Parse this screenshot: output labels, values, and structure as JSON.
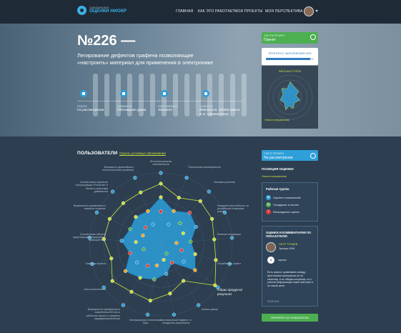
{
  "header": {
    "logo_sub": "САМОАНАЛИЗ",
    "logo_title": "ОЦЕНКИ НИОКР",
    "nav": [
      "ГЛАВНАЯ",
      "КАК ЭТО РАБОТАЕТ",
      "МОИ ПРОЕКТЫ",
      "МОЯ ПЕРСПЕКТИВА"
    ]
  },
  "hero": {
    "title": "№226 —",
    "subtitle": "Легирование дефектов графена позволяющие «настроить» материал для применения в электронике",
    "meta": [
      {
        "label": "СТАТУС",
        "value": "На рассмотрении"
      },
      {
        "label": "ДИВИЗИОН",
        "value": "Облгащение урана"
      },
      {
        "label": "НАПРАВЛЕНИЕ",
        "value": "Экология"
      },
      {
        "label": "ЗАКАЗЧИК",
        "value": "Иванов В.В. (ОКБМ имени И.И. Африкантова)"
      }
    ],
    "status_card": {
      "label": "ЭТАП ПО ПРОЕКТУ",
      "value": "Принят"
    },
    "progress": {
      "label": "ПРОГРЕСС ЗАПОЛНЕНИЯ 93%",
      "value": 0.93
    },
    "mini_radar_title": "РАБОЧАЯ ГРУППА",
    "mini_legend": "Эталон направления"
  },
  "section": {
    "title": "ПОЛЬЗОВАТЕЛИ",
    "link": "Скрыть условные обозначения",
    "highlight_label": "Образ продукта/ результат"
  },
  "radar_labels": [
    "Интеллектуальная собственность",
    "Техническая реализуемость",
    "Наличие решения",
    "Конкурентоспособность на российском и мировом рынке",
    "Наличие мотивации",
    "Потребитель клиент",
    "Образ продукта/ результат",
    "Анализ рынка",
    "Экономический эффект от внедрения результатов",
    "Материальная техническая база",
    "Возможности применения в изменённых ВН или в субъектах малого и среднего предпринимательства",
    "Опыт исполнителя",
    "Команда проекта",
    "Соответствие объекта существующей нормативно-правовой базе",
    "Возможность применения в смежных отраслях",
    "Соответствие стратегии госкорпорации «Росатом» и бизнес-стратегиям дивизионов",
    "Значимость дальнейшего технологического развития"
  ],
  "sidebar": {
    "status": {
      "label": "СТАТУС ПРОЕКТА",
      "value": "На рассмотрении"
    },
    "position_title": "ПОЗИЦИЯ ОЦЕНКИ",
    "position_sub": "Эталон направления",
    "group_title": "Рабочая группа",
    "legend": [
      {
        "num": "16",
        "label": "Оценено показателей",
        "color": "#2e9fd8"
      },
      {
        "num": "13",
        "label": "Попадание в эталон",
        "color": "#4caf50"
      },
      {
        "num": "7",
        "label": "Расхождение оценок",
        "color": "#e53935"
      }
    ],
    "comments_title": "ОЦЕНКИ И КОММЕНТАРИИ ПО ПОКАЗАТЕЛЮ",
    "person_name": "ПЕТР ТУПАЕВ",
    "person_role": "Эксперт БУМ",
    "score": "4",
    "score_label": "оценка",
    "comment": "Есть аналог сравнивать между, прототипом материалы не по качеству, а по общим затратам, но с учетом информации какие материя и по какой цене.",
    "comment_date": "30.08.2014",
    "next_button": "ПЕРЕЙТИ НА ПОКАЗАТЕЛЬ"
  },
  "colors": {
    "accent": "#2e9fd8",
    "green": "#4caf50",
    "lime": "#cde03c",
    "bg": "#2c3e50"
  }
}
